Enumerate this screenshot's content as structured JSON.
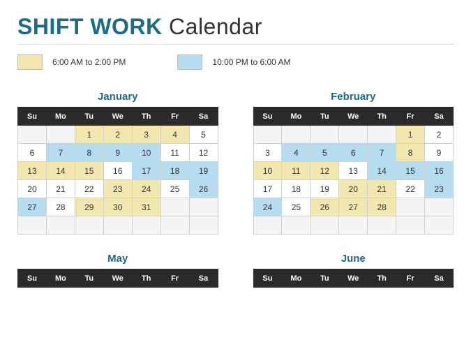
{
  "title": {
    "bold": "SHIFT WORK",
    "rest": " Calendar"
  },
  "legend": {
    "yellow": "6:00 AM to 2:00 PM",
    "blue": "10:00 PM to 6:00 AM"
  },
  "dayHeaders": [
    "Su",
    "Mo",
    "Tu",
    "We",
    "Th",
    "Fr",
    "Sa"
  ],
  "months": [
    {
      "name": "January",
      "rows": [
        [
          [
            "",
            "e"
          ],
          [
            "",
            "e"
          ],
          [
            "1",
            "y"
          ],
          [
            "2",
            "y"
          ],
          [
            "3",
            "y"
          ],
          [
            "4",
            "y"
          ],
          [
            "5",
            "w"
          ]
        ],
        [
          [
            "6",
            "w"
          ],
          [
            "7",
            "b"
          ],
          [
            "8",
            "b"
          ],
          [
            "9",
            "b"
          ],
          [
            "10",
            "b"
          ],
          [
            "11",
            "w"
          ],
          [
            "12",
            "w"
          ]
        ],
        [
          [
            "13",
            "y"
          ],
          [
            "14",
            "y"
          ],
          [
            "15",
            "y"
          ],
          [
            "16",
            "w"
          ],
          [
            "17",
            "b"
          ],
          [
            "18",
            "b"
          ],
          [
            "19",
            "b"
          ]
        ],
        [
          [
            "20",
            "w"
          ],
          [
            "21",
            "w"
          ],
          [
            "22",
            "w"
          ],
          [
            "23",
            "y"
          ],
          [
            "24",
            "y"
          ],
          [
            "25",
            "w"
          ],
          [
            "26",
            "b"
          ]
        ],
        [
          [
            "27",
            "b"
          ],
          [
            "28",
            "w"
          ],
          [
            "29",
            "y"
          ],
          [
            "30",
            "y"
          ],
          [
            "31",
            "y"
          ],
          [
            "",
            "e"
          ],
          [
            "",
            "e"
          ]
        ],
        [
          [
            "",
            "e"
          ],
          [
            "",
            "e"
          ],
          [
            "",
            "e"
          ],
          [
            "",
            "e"
          ],
          [
            "",
            "e"
          ],
          [
            "",
            "e"
          ],
          [
            "",
            "e"
          ]
        ]
      ]
    },
    {
      "name": "February",
      "rows": [
        [
          [
            "",
            "e"
          ],
          [
            "",
            "e"
          ],
          [
            "",
            "e"
          ],
          [
            "",
            "e"
          ],
          [
            "",
            "e"
          ],
          [
            "1",
            "y"
          ],
          [
            "2",
            "w"
          ]
        ],
        [
          [
            "3",
            "w"
          ],
          [
            "4",
            "b"
          ],
          [
            "5",
            "b"
          ],
          [
            "6",
            "b"
          ],
          [
            "7",
            "b"
          ],
          [
            "8",
            "y"
          ],
          [
            "9",
            "w"
          ]
        ],
        [
          [
            "10",
            "y"
          ],
          [
            "11",
            "y"
          ],
          [
            "12",
            "y"
          ],
          [
            "13",
            "w"
          ],
          [
            "14",
            "b"
          ],
          [
            "15",
            "b"
          ],
          [
            "16",
            "b"
          ]
        ],
        [
          [
            "17",
            "w"
          ],
          [
            "18",
            "w"
          ],
          [
            "19",
            "w"
          ],
          [
            "20",
            "y"
          ],
          [
            "21",
            "y"
          ],
          [
            "22",
            "w"
          ],
          [
            "23",
            "b"
          ]
        ],
        [
          [
            "24",
            "b"
          ],
          [
            "25",
            "w"
          ],
          [
            "26",
            "y"
          ],
          [
            "27",
            "y"
          ],
          [
            "28",
            "y"
          ],
          [
            "",
            "e"
          ],
          [
            "",
            "e"
          ]
        ],
        [
          [
            "",
            "e"
          ],
          [
            "",
            "e"
          ],
          [
            "",
            "e"
          ],
          [
            "",
            "e"
          ],
          [
            "",
            "e"
          ],
          [
            "",
            "e"
          ],
          [
            "",
            "e"
          ]
        ]
      ]
    },
    {
      "name": "May",
      "rows": []
    },
    {
      "name": "June",
      "rows": []
    }
  ]
}
